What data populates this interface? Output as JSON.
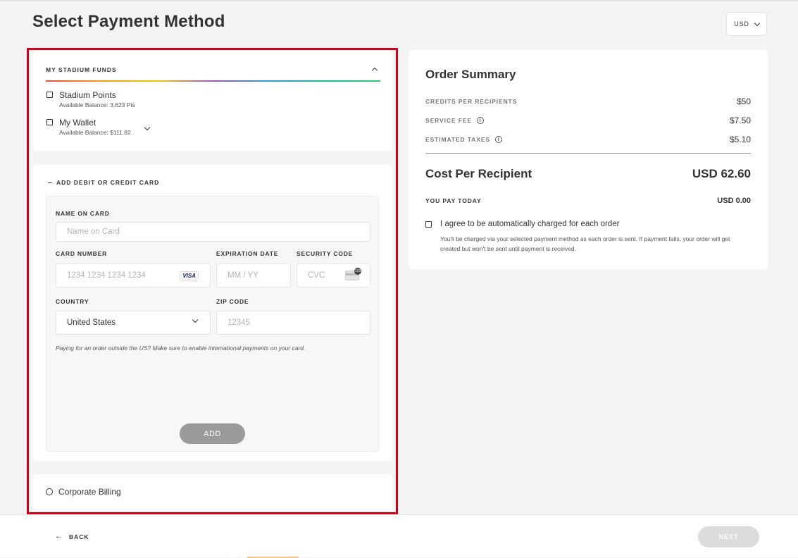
{
  "page": {
    "title": "Select Payment Method"
  },
  "currency": {
    "selected": "USD"
  },
  "funds": {
    "header": "MY STADIUM FUNDS",
    "items": [
      {
        "label": "Stadium Points",
        "balance": "Available Balance: 3,623 Pts"
      },
      {
        "label": "My Wallet",
        "balance": "Available Balance: $111.82"
      }
    ]
  },
  "card": {
    "header": "ADD DEBIT OR CREDIT CARD",
    "name_label": "NAME ON CARD",
    "name_placeholder": "Name on Card",
    "number_label": "CARD NUMBER",
    "number_placeholder": "1234 1234 1234 1234",
    "brand": "VISA",
    "exp_label": "EXPIRATION DATE",
    "exp_placeholder": "MM / YY",
    "cvc_label": "SECURITY CODE",
    "cvc_placeholder": "CVC",
    "country_label": "COUNTRY",
    "country_value": "United States",
    "zip_label": "ZIP CODE",
    "zip_placeholder": "12345",
    "note": "Paying for an order outside the US? Make sure to enable international payments on your card.",
    "add_label": "ADD"
  },
  "corporate": {
    "label": "Corporate Billing"
  },
  "summary": {
    "title": "Order Summary",
    "rows": [
      {
        "label": "CREDITS PER RECIPIENTS",
        "value": "$50"
      },
      {
        "label": "SERVICE FEE",
        "value": "$7.50"
      },
      {
        "label": "ESTIMATED TAXES",
        "value": "$5.10"
      }
    ],
    "cost_label": "Cost Per Recipient",
    "cost_value": "USD 62.60",
    "pay_label": "YOU PAY TODAY",
    "pay_value": "USD 0.00",
    "agree_label": "I agree to be automatically charged for each order",
    "agree_note": "You'll be charged via your selected payment method as each order is sent. If payment fails, your order will get created but won't be sent until payment is received."
  },
  "footer": {
    "back_label": "BACK",
    "next_label": "NEXT"
  }
}
